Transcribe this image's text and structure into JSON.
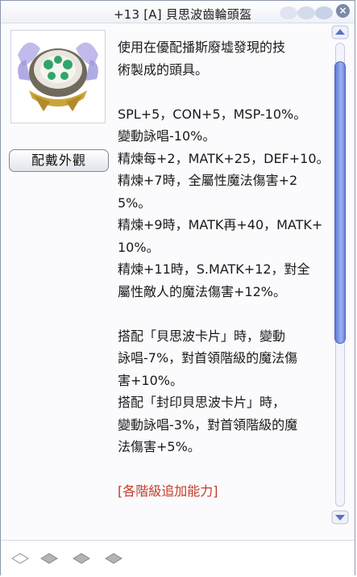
{
  "window": {
    "title": "+13 [A] 貝思波齒輪頭盔",
    "close_label": "×"
  },
  "item": {
    "image_icon": "gear-helmet-icon",
    "look_button_label": "配戴外觀"
  },
  "description": {
    "lines": [
      "使用在優配播斯廢墟發現的技",
      "術製成的頭具。",
      "",
      "SPL+5，CON+5，MSP-10%。",
      "變動詠唱-10%。",
      "精煉每+2，MATK+25，DEF+10。",
      "精煉+7時，全屬性魔法傷害+2",
      "5%。",
      "精煉+9時，MATK再+40，MATK+",
      "10%。",
      "精煉+11時，S.MATK+12，對全",
      "屬性敵人的魔法傷害+12%。",
      "",
      "搭配「貝思波卡片」時，變動",
      "詠唱-7%，對首領階級的魔法傷",
      "害+10%。",
      "搭配「封印貝思波卡片」時，",
      "變動詠唱-3%，對首領階級的魔",
      "法傷害+5%。",
      ""
    ],
    "link_text": "[各階級追加能力]",
    "link_color": "#c53a28"
  },
  "scrollbar": {
    "up_icon": "scroll-up-arrow-icon",
    "down_icon": "scroll-down-arrow-icon",
    "accent": "#6a83dc"
  },
  "slots": {
    "icons": [
      "empty-slot-icon",
      "filled-slot-icon",
      "filled-slot-icon",
      "filled-slot-icon"
    ]
  }
}
